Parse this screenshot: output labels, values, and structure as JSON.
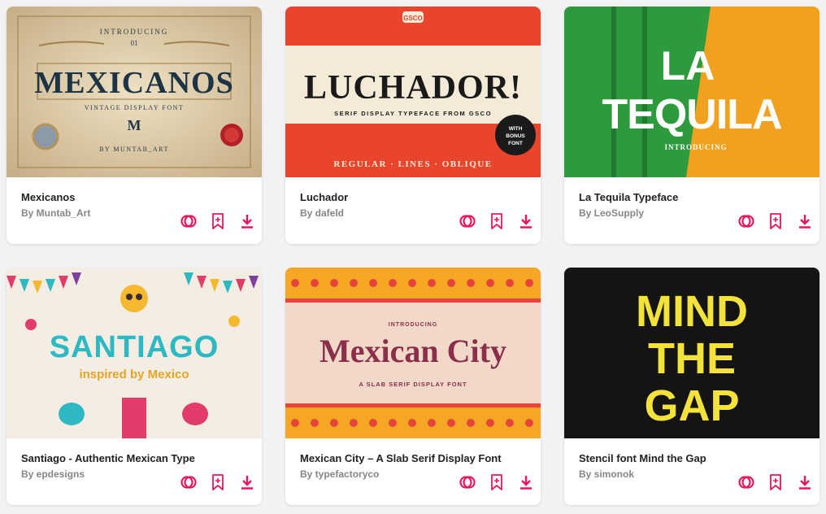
{
  "accent": "#e8175d",
  "cards": [
    {
      "title": "Mexicanos",
      "author": "By Muntab_Art",
      "thumb": {
        "intro": "INTRODUCING",
        "num": "01",
        "name": "MEXICANOS",
        "sub": "VINTAGE DISPLAY FONT",
        "mono": "M",
        "by": "BY MUNTAB_ART"
      }
    },
    {
      "title": "Luchador",
      "author": "By dafeld",
      "thumb": {
        "badge": "GSCO",
        "name": "LUCHADOR!",
        "sub": "SERIF DISPLAY TYPEFACE FROM GSCO",
        "bonus1": "WITH",
        "bonus2": "BONUS",
        "bonus3": "FONT",
        "styles": "REGULAR · LINES · OBLIQUE"
      }
    },
    {
      "title": "La Tequila Typeface",
      "author": "By LeoSupply",
      "thumb": {
        "line1": "LA",
        "line2": "TEQUILA",
        "intro": "INTRODUCING"
      }
    },
    {
      "title": "Santiago - Authentic Mexican Type",
      "author": "By epdesigns",
      "thumb": {
        "name": "SANTIAGO",
        "tagline": "inspired by Mexico"
      }
    },
    {
      "title": "Mexican City – A Slab Serif Display Font",
      "author": "By typefactoryco",
      "thumb": {
        "intro": "INTRODUCING",
        "name": "Mexican City",
        "sub": "A SLAB SERIF DISPLAY FONT"
      }
    },
    {
      "title": "Stencil font Mind the Gap",
      "author": "By simonok",
      "thumb": {
        "line1": "MIND",
        "line2": "THE",
        "line3": "GAP"
      }
    }
  ]
}
